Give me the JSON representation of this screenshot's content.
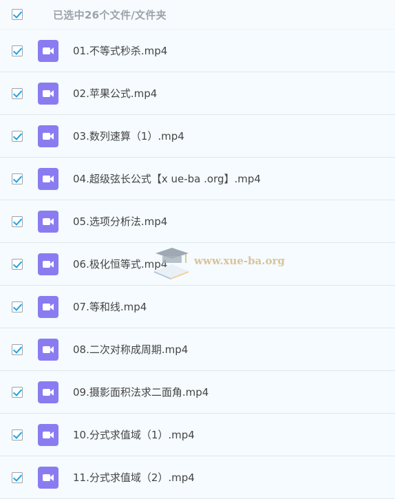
{
  "header": {
    "label": "已选中26个文件/文件夹",
    "all_checked": true
  },
  "files": [
    {
      "name": "01.不等式秒杀.mp4",
      "checked": true,
      "icon": "video-file-icon"
    },
    {
      "name": "02.苹果公式.mp4",
      "checked": true,
      "icon": "video-file-icon"
    },
    {
      "name": "03.数列速算（1）.mp4",
      "checked": true,
      "icon": "video-file-icon"
    },
    {
      "name": "04.超级弦长公式【x ue-ba .org】.mp4",
      "checked": true,
      "icon": "video-file-icon"
    },
    {
      "name": "05.选项分析法.mp4",
      "checked": true,
      "icon": "video-file-icon"
    },
    {
      "name": "06.极化恒等式.mp4",
      "checked": true,
      "icon": "video-file-icon"
    },
    {
      "name": "07.等和线.mp4",
      "checked": true,
      "icon": "video-file-icon"
    },
    {
      "name": "08.二次对称成周期.mp4",
      "checked": true,
      "icon": "video-file-icon"
    },
    {
      "name": "09.摄影面积法求二面角.mp4",
      "checked": true,
      "icon": "video-file-icon"
    },
    {
      "name": "10.分式求值域（1）.mp4",
      "checked": true,
      "icon": "video-file-icon"
    },
    {
      "name": "11.分式求值域（2）.mp4",
      "checked": true,
      "icon": "video-file-icon"
    }
  ],
  "watermark": {
    "text": "www.xue-ba.org"
  },
  "colors": {
    "accent": "#1aa3e4",
    "video_icon": "#8a7cf0",
    "row_bg": "#f5fbfe",
    "header_text": "#9aa3ab"
  }
}
